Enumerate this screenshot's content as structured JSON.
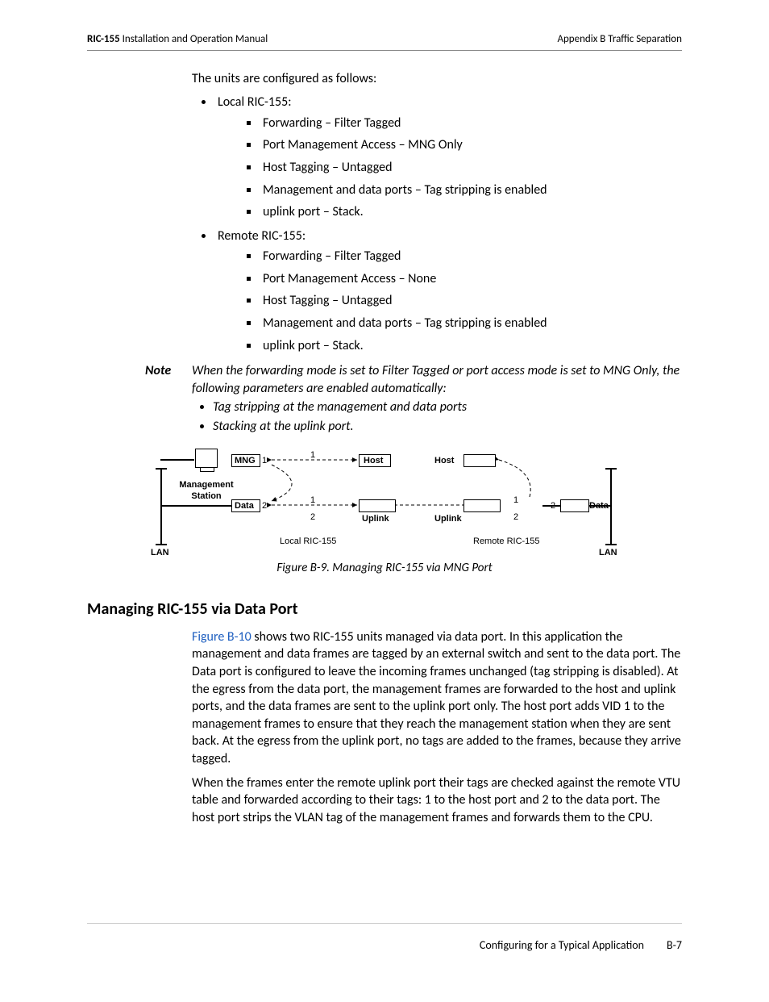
{
  "header": {
    "left_bold": "RIC-155",
    "left_rest": " Installation and Operation Manual",
    "right": "Appendix B  Traffic Separation"
  },
  "intro": "The units are configured as follows:",
  "local_title": "Local RIC-155:",
  "local_items": [
    "Forwarding – Filter Tagged",
    "Port Management Access – MNG Only",
    "Host Tagging – Untagged",
    "Management and data ports – Tag stripping is enabled",
    "uplink port – Stack."
  ],
  "remote_title": "Remote RIC-155:",
  "remote_items": [
    "Forwarding – Filter Tagged",
    "Port Management Access – None",
    "Host Tagging – Untagged",
    "Management and data ports – Tag stripping is enabled",
    "uplink port – Stack."
  ],
  "note": {
    "label": "Note",
    "lead": "When the forwarding mode is set to Filter Tagged or port access mode is set to MNG Only, the following parameters are enabled automatically:",
    "items": [
      "Tag stripping at the management and data ports",
      "Stacking at the uplink port."
    ]
  },
  "figure": {
    "labels": {
      "mng": "MNG",
      "host1": "Host",
      "host2": "Host",
      "data": "Data",
      "data2": "Data",
      "uplink1": "Uplink",
      "uplink2": "Uplink",
      "mgmt_station": "Management Station",
      "local": "Local RIC-155",
      "remote": "Remote RIC-155",
      "lan": "LAN",
      "lan2": "LAN"
    },
    "nums": {
      "one": "1",
      "two": "2"
    },
    "caption": "Figure B-9.  Managing RIC-155 via MNG Port"
  },
  "section": {
    "heading": "Managing RIC-155 via Data Port",
    "link": "Figure B-10",
    "para1_rest": " shows two RIC-155 units managed via data port. In this application the management and data frames are tagged by an external switch and sent to the data port. The Data port is configured to leave the incoming frames unchanged (tag stripping is disabled). At the egress from the data port, the management frames are forwarded to the host and uplink ports, and the data frames are sent to the uplink port only. The host port adds VID 1 to the management frames to ensure that they reach the management station when they are sent back. At the egress from the uplink port, no tags are added to the frames, because they arrive tagged.",
    "para2": "When the frames enter the remote uplink port their tags are checked against the remote VTU table and forwarded according to their tags: 1 to the host port and 2 to the data port. The host port strips the VLAN tag of the management frames and forwards them to the CPU."
  },
  "footer": {
    "text": "Configuring for a Typical Application",
    "page": "B-7"
  }
}
